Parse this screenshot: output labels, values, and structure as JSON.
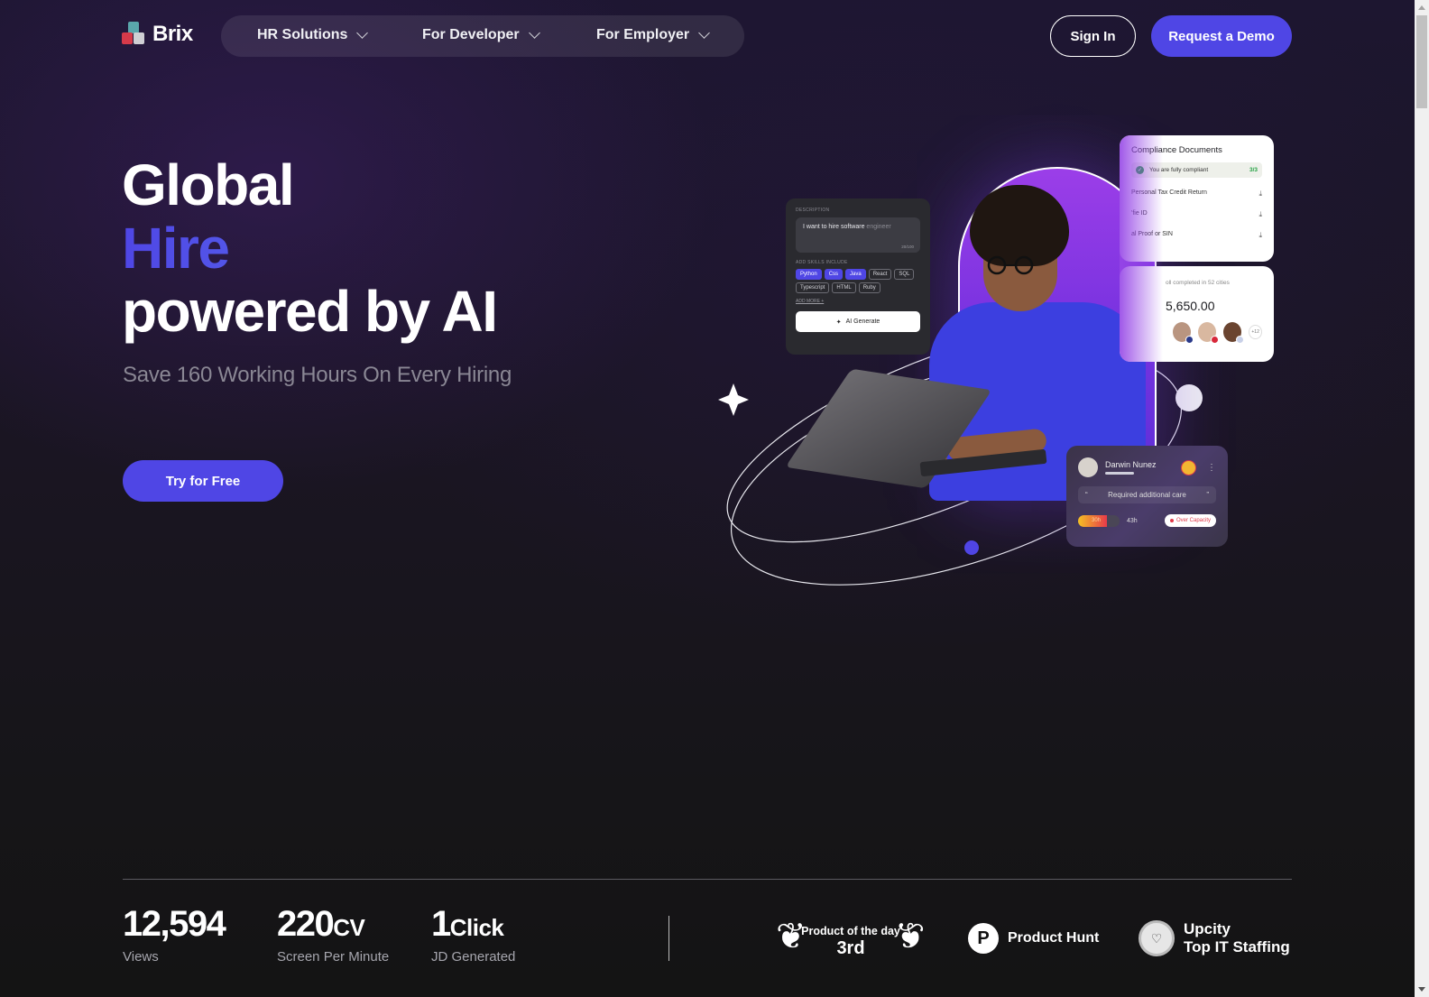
{
  "brand": {
    "name": "Brix"
  },
  "nav": {
    "items": [
      {
        "label": "HR Solutions"
      },
      {
        "label": "For Developer"
      },
      {
        "label": "For Employer"
      }
    ],
    "sign_in": "Sign In",
    "request_demo": "Request a Demo"
  },
  "hero": {
    "line1": "Global",
    "line2": "Hire",
    "line3": "powered by AI",
    "subtitle": "Save 160 Working Hours On Every Hiring",
    "cta": "Try for Free",
    "accent_color": "#4f46e5"
  },
  "jd_card": {
    "description_label": "DESCRIPTION",
    "description_typed": "I want to hire software",
    "description_suggestion": " engineer",
    "char_count": "20/100",
    "skills_label": "ADD SKILLS INCLUDE",
    "skills": [
      {
        "label": "Python",
        "selected": true
      },
      {
        "label": "Css",
        "selected": true
      },
      {
        "label": "Java",
        "selected": true
      },
      {
        "label": "React",
        "selected": false
      },
      {
        "label": "SQL",
        "selected": false
      },
      {
        "label": "Typescript",
        "selected": false
      },
      {
        "label": "HTML",
        "selected": false
      },
      {
        "label": "Ruby",
        "selected": false
      }
    ],
    "add_more": "ADD MORE +",
    "generate_button": "AI Generate"
  },
  "compliance_card": {
    "title": "Compliance Documents",
    "status": "You are fully compliant",
    "status_count": "3/3",
    "documents": [
      {
        "name": "Personal Tax Credit Return"
      },
      {
        "name": "'fie ID"
      },
      {
        "name": "al Proof or SIN"
      }
    ]
  },
  "payroll_card": {
    "subtitle": "oll completed in 52 cities",
    "amount": "5,650.00",
    "more_count": "+12"
  },
  "employee_card": {
    "name": "Darwin Nunez",
    "note": "Required additional care",
    "hours_logged": "30h",
    "hours_total": "43h",
    "hours_fraction": 0.7,
    "status": "Over Capacity"
  },
  "stats": [
    {
      "value": "12,594",
      "unit": "",
      "label": "Views"
    },
    {
      "value": "220",
      "unit": "CV",
      "label": "Screen Per Minute"
    },
    {
      "value": "1",
      "unit": "Click",
      "label": "JD Generated"
    }
  ],
  "awards": {
    "product_of_day": {
      "title": "Product of the day",
      "rank": "3rd"
    },
    "product_hunt": {
      "icon_letter": "P",
      "label": "Product Hunt"
    },
    "upcity": {
      "line1": "Upcity",
      "line2": "Top IT Staffing"
    }
  }
}
